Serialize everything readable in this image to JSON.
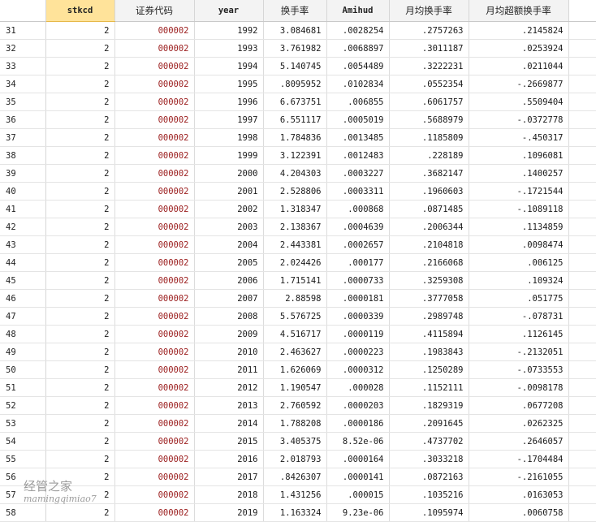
{
  "table": {
    "headers": [
      "stkcd",
      "证券代码",
      "year",
      "换手率",
      "Amihud",
      "月均换手率",
      "月均超额换手率"
    ],
    "selected_header": "stkcd",
    "rows": [
      {
        "n": "31",
        "stkcd": "2",
        "code": "000002",
        "year": "1992",
        "turnover": "3.084681",
        "amihud": ".0028254",
        "mturn": ".2757263",
        "mexcess": ".2145824"
      },
      {
        "n": "32",
        "stkcd": "2",
        "code": "000002",
        "year": "1993",
        "turnover": "3.761982",
        "amihud": ".0068897",
        "mturn": ".3011187",
        "mexcess": ".0253924"
      },
      {
        "n": "33",
        "stkcd": "2",
        "code": "000002",
        "year": "1994",
        "turnover": "5.140745",
        "amihud": ".0054489",
        "mturn": ".3222231",
        "mexcess": ".0211044"
      },
      {
        "n": "34",
        "stkcd": "2",
        "code": "000002",
        "year": "1995",
        "turnover": ".8095952",
        "amihud": ".0102834",
        "mturn": ".0552354",
        "mexcess": "-.2669877"
      },
      {
        "n": "35",
        "stkcd": "2",
        "code": "000002",
        "year": "1996",
        "turnover": "6.673751",
        "amihud": ".006855",
        "mturn": ".6061757",
        "mexcess": ".5509404"
      },
      {
        "n": "36",
        "stkcd": "2",
        "code": "000002",
        "year": "1997",
        "turnover": "6.551117",
        "amihud": ".0005019",
        "mturn": ".5688979",
        "mexcess": "-.0372778"
      },
      {
        "n": "37",
        "stkcd": "2",
        "code": "000002",
        "year": "1998",
        "turnover": "1.784836",
        "amihud": ".0013485",
        "mturn": ".1185809",
        "mexcess": "-.450317"
      },
      {
        "n": "38",
        "stkcd": "2",
        "code": "000002",
        "year": "1999",
        "turnover": "3.122391",
        "amihud": ".0012483",
        "mturn": ".228189",
        "mexcess": ".1096081"
      },
      {
        "n": "39",
        "stkcd": "2",
        "code": "000002",
        "year": "2000",
        "turnover": "4.204303",
        "amihud": ".0003227",
        "mturn": ".3682147",
        "mexcess": ".1400257"
      },
      {
        "n": "40",
        "stkcd": "2",
        "code": "000002",
        "year": "2001",
        "turnover": "2.528806",
        "amihud": ".0003311",
        "mturn": ".1960603",
        "mexcess": "-.1721544"
      },
      {
        "n": "41",
        "stkcd": "2",
        "code": "000002",
        "year": "2002",
        "turnover": "1.318347",
        "amihud": ".000868",
        "mturn": ".0871485",
        "mexcess": "-.1089118"
      },
      {
        "n": "42",
        "stkcd": "2",
        "code": "000002",
        "year": "2003",
        "turnover": "2.138367",
        "amihud": ".0004639",
        "mturn": ".2006344",
        "mexcess": ".1134859"
      },
      {
        "n": "43",
        "stkcd": "2",
        "code": "000002",
        "year": "2004",
        "turnover": "2.443381",
        "amihud": ".0002657",
        "mturn": ".2104818",
        "mexcess": ".0098474"
      },
      {
        "n": "44",
        "stkcd": "2",
        "code": "000002",
        "year": "2005",
        "turnover": "2.024426",
        "amihud": ".000177",
        "mturn": ".2166068",
        "mexcess": ".006125"
      },
      {
        "n": "45",
        "stkcd": "2",
        "code": "000002",
        "year": "2006",
        "turnover": "1.715141",
        "amihud": ".0000733",
        "mturn": ".3259308",
        "mexcess": ".109324"
      },
      {
        "n": "46",
        "stkcd": "2",
        "code": "000002",
        "year": "2007",
        "turnover": "2.88598",
        "amihud": ".0000181",
        "mturn": ".3777058",
        "mexcess": ".051775"
      },
      {
        "n": "47",
        "stkcd": "2",
        "code": "000002",
        "year": "2008",
        "turnover": "5.576725",
        "amihud": ".0000339",
        "mturn": ".2989748",
        "mexcess": "-.078731"
      },
      {
        "n": "48",
        "stkcd": "2",
        "code": "000002",
        "year": "2009",
        "turnover": "4.516717",
        "amihud": ".0000119",
        "mturn": ".4115894",
        "mexcess": ".1126145"
      },
      {
        "n": "49",
        "stkcd": "2",
        "code": "000002",
        "year": "2010",
        "turnover": "2.463627",
        "amihud": ".0000223",
        "mturn": ".1983843",
        "mexcess": "-.2132051"
      },
      {
        "n": "50",
        "stkcd": "2",
        "code": "000002",
        "year": "2011",
        "turnover": "1.626069",
        "amihud": ".0000312",
        "mturn": ".1250289",
        "mexcess": "-.0733553"
      },
      {
        "n": "51",
        "stkcd": "2",
        "code": "000002",
        "year": "2012",
        "turnover": "1.190547",
        "amihud": ".000028",
        "mturn": ".1152111",
        "mexcess": "-.0098178"
      },
      {
        "n": "52",
        "stkcd": "2",
        "code": "000002",
        "year": "2013",
        "turnover": "2.760592",
        "amihud": ".0000203",
        "mturn": ".1829319",
        "mexcess": ".0677208"
      },
      {
        "n": "53",
        "stkcd": "2",
        "code": "000002",
        "year": "2014",
        "turnover": "1.788208",
        "amihud": ".0000186",
        "mturn": ".2091645",
        "mexcess": ".0262325"
      },
      {
        "n": "54",
        "stkcd": "2",
        "code": "000002",
        "year": "2015",
        "turnover": "3.405375",
        "amihud": "8.52e-06",
        "mturn": ".4737702",
        "mexcess": ".2646057"
      },
      {
        "n": "55",
        "stkcd": "2",
        "code": "000002",
        "year": "2016",
        "turnover": "2.018793",
        "amihud": ".0000164",
        "mturn": ".3033218",
        "mexcess": "-.1704484"
      },
      {
        "n": "56",
        "stkcd": "2",
        "code": "000002",
        "year": "2017",
        "turnover": ".8426307",
        "amihud": ".0000141",
        "mturn": ".0872163",
        "mexcess": "-.2161055"
      },
      {
        "n": "57",
        "stkcd": "2",
        "code": "000002",
        "year": "2018",
        "turnover": "1.431256",
        "amihud": ".000015",
        "mturn": ".1035216",
        "mexcess": ".0163053"
      },
      {
        "n": "58",
        "stkcd": "2",
        "code": "000002",
        "year": "2019",
        "turnover": "1.163324",
        "amihud": "9.23e-06",
        "mturn": ".1095974",
        "mexcess": ".0060758"
      }
    ]
  },
  "watermark": {
    "name": "经管之家",
    "handle": "mamingqimiao7"
  }
}
